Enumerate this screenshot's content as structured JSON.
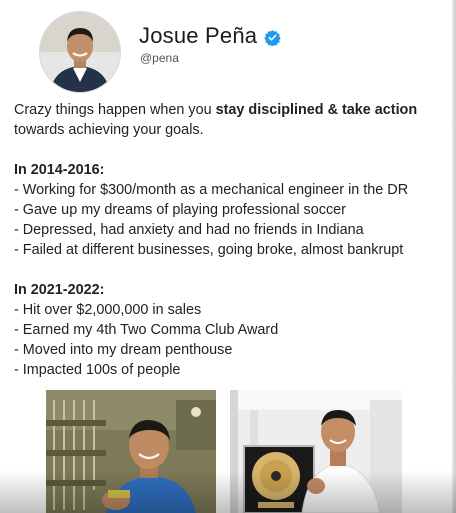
{
  "profile": {
    "name": "Josue Peña",
    "handle": "@pena",
    "avatar_icon": "person-photo",
    "verified_icon": "verified-badge-icon",
    "verified_color": "#1d9bf0"
  },
  "post": {
    "intro_part1": "Crazy things happen when you ",
    "intro_bold": "stay disciplined & take action",
    "intro_part2": "towards achieving your goals.",
    "section1": {
      "heading": "In 2014-2016:",
      "items": [
        "- Working for $300/month as a mechanical engineer in the DR",
        "- Gave up my dreams of playing professional soccer",
        "- Depressed, had anxiety and had no friends in Indiana",
        "- Failed at different businesses, going broke, almost bankrupt"
      ]
    },
    "section2": {
      "heading": "In 2021-2022:",
      "items": [
        "- Hit over $2,000,000 in sales",
        "- Earned my 4th Two Comma Club Award",
        "- Moved into my dream penthouse",
        "- Impacted 100s of people"
      ]
    }
  },
  "images": [
    {
      "name": "workshop-photo",
      "accent": "#2f6fc0"
    },
    {
      "name": "award-photo",
      "accent": "#f2f2f2"
    }
  ]
}
